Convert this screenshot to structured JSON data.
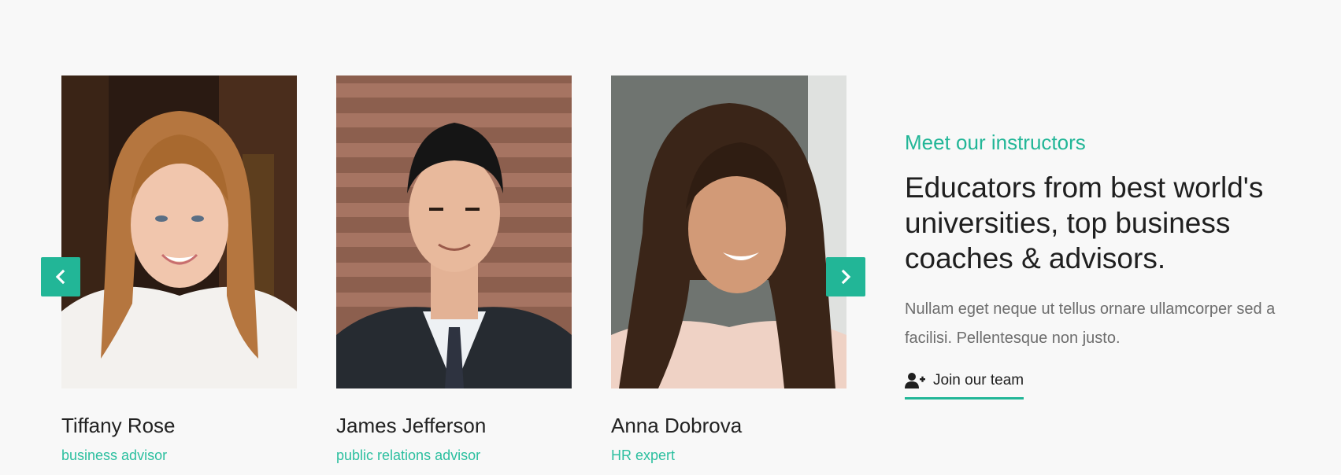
{
  "team": [
    {
      "name": "Tiffany Rose",
      "role": "business advisor"
    },
    {
      "name": "James Jefferson",
      "role": "public relations advisor"
    },
    {
      "name": "Anna Dobrova",
      "role": "HR expert"
    }
  ],
  "carousel": {
    "prev_icon": "chevron-left-icon",
    "next_icon": "chevron-right-icon"
  },
  "info": {
    "eyebrow": "Meet our instructors",
    "headline": "Educators from best world's universities, top business coaches & advisors.",
    "description": "Nullam eget neque ut tellus ornare ullamcorper sed a facilisi. Pellentesque non justo.",
    "cta_label": "Join our team",
    "cta_icon": "user-plus-icon"
  },
  "colors": {
    "accent": "#22b697",
    "background": "#f8f8f8",
    "text": "#1f1f1f",
    "muted": "#6d6d6d"
  }
}
